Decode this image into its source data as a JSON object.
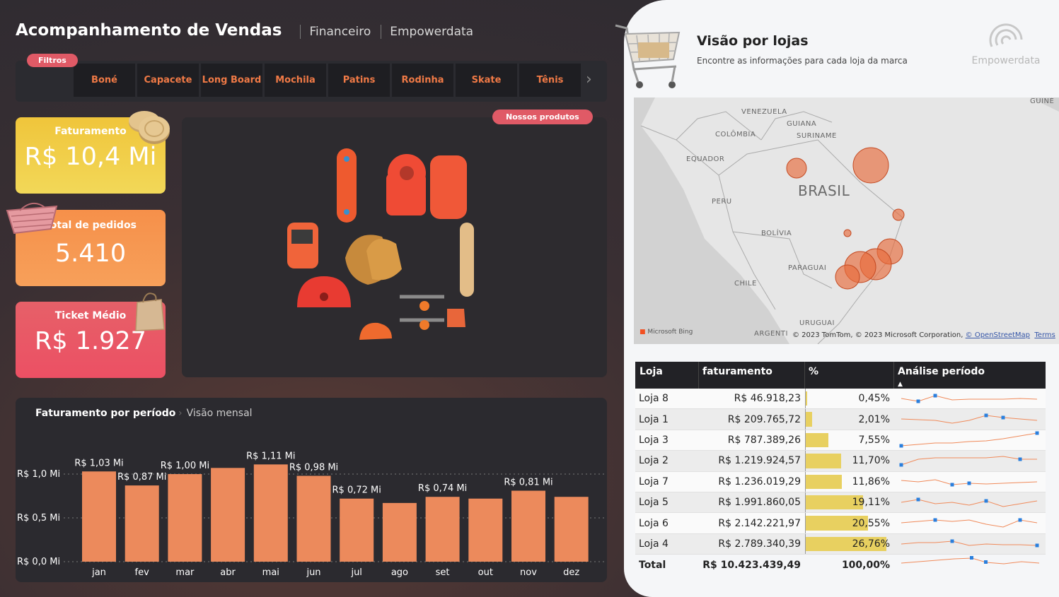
{
  "header": {
    "title": "Acompanhamento de Vendas",
    "crumbs": [
      "Financeiro",
      "Empowerdata"
    ]
  },
  "filters": {
    "badge": "Filtros",
    "items": [
      "Boné",
      "Capacete",
      "Long Board",
      "Mochila",
      "Patins",
      "Rodinha",
      "Skate",
      "Tênis"
    ]
  },
  "kpis": {
    "faturamento": {
      "label": "Faturamento",
      "value": "R$ 10,4 Mi"
    },
    "pedidos": {
      "label": "Total de pedidos",
      "value": "5.410"
    },
    "ticket": {
      "label": "Ticket Médio",
      "value": "R$ 1.927"
    }
  },
  "products": {
    "badge": "Nossos produtos"
  },
  "chart_data": {
    "type": "bar",
    "title": "Faturamento por período",
    "subtitle": "Visão mensal",
    "categories": [
      "jan",
      "fev",
      "mar",
      "abr",
      "mai",
      "jun",
      "jul",
      "ago",
      "set",
      "out",
      "nov",
      "dez"
    ],
    "values": [
      1.03,
      0.87,
      1.0,
      1.07,
      1.11,
      0.98,
      0.72,
      0.67,
      0.74,
      0.72,
      0.81,
      0.74
    ],
    "data_labels": [
      "R$ 1,03 Mi",
      "R$ 0,87 Mi",
      "R$ 1,00 Mi",
      "",
      "R$ 1,11 Mi",
      "R$ 0,98 Mi",
      "R$ 0,72 Mi",
      "",
      "R$ 0,74 Mi",
      "",
      "R$ 0,81 Mi",
      ""
    ],
    "yticks": [
      {
        "v": 0,
        "label": "R$ 0,0 Mi"
      },
      {
        "v": 0.5,
        "label": "R$ 0,5 Mi"
      },
      {
        "v": 1.0,
        "label": "R$ 1,0 Mi"
      }
    ],
    "ylim": [
      0,
      1.2
    ],
    "color": "#ec8a5c"
  },
  "stores": {
    "title": "Visão por lojas",
    "subtitle": "Encontre as informações para cada loja da marca",
    "brand": "Empowerdata"
  },
  "map": {
    "labels": [
      "VENEZUELA",
      "GUIANA",
      "SURINAME",
      "COLÔMBIA",
      "EQUADOR",
      "BRASIL",
      "PERU",
      "BOLÍVIA",
      "PARAGUAI",
      "CHILE",
      "URUGUAI",
      "ARGENTI",
      "GUINÉ"
    ],
    "credit": "© 2023 TomTom, © 2023 Microsoft Corporation,",
    "osm": "© OpenStreetMap",
    "terms": "Terms",
    "bing": "Microsoft Bing"
  },
  "table": {
    "headers": [
      "Loja",
      "faturamento",
      "%",
      "Análise período"
    ],
    "rows": [
      {
        "loja": "Loja 8",
        "fat": "R$ 46.918,23",
        "pct": "0,45%",
        "p": 0.45
      },
      {
        "loja": "Loja 1",
        "fat": "R$ 209.765,72",
        "pct": "2,01%",
        "p": 2.01
      },
      {
        "loja": "Loja 3",
        "fat": "R$ 787.389,26",
        "pct": "7,55%",
        "p": 7.55
      },
      {
        "loja": "Loja 2",
        "fat": "R$ 1.219.924,57",
        "pct": "11,70%",
        "p": 11.7
      },
      {
        "loja": "Loja 7",
        "fat": "R$ 1.236.019,29",
        "pct": "11,86%",
        "p": 11.86
      },
      {
        "loja": "Loja 5",
        "fat": "R$ 1.991.860,05",
        "pct": "19,11%",
        "p": 19.11
      },
      {
        "loja": "Loja 6",
        "fat": "R$ 2.142.221,97",
        "pct": "20,55%",
        "p": 20.55
      },
      {
        "loja": "Loja 4",
        "fat": "R$ 2.789.340,39",
        "pct": "26,76%",
        "p": 26.76
      }
    ],
    "total": {
      "label": "Total",
      "fat": "R$ 10.423.439,49",
      "pct": "100,00%"
    }
  }
}
